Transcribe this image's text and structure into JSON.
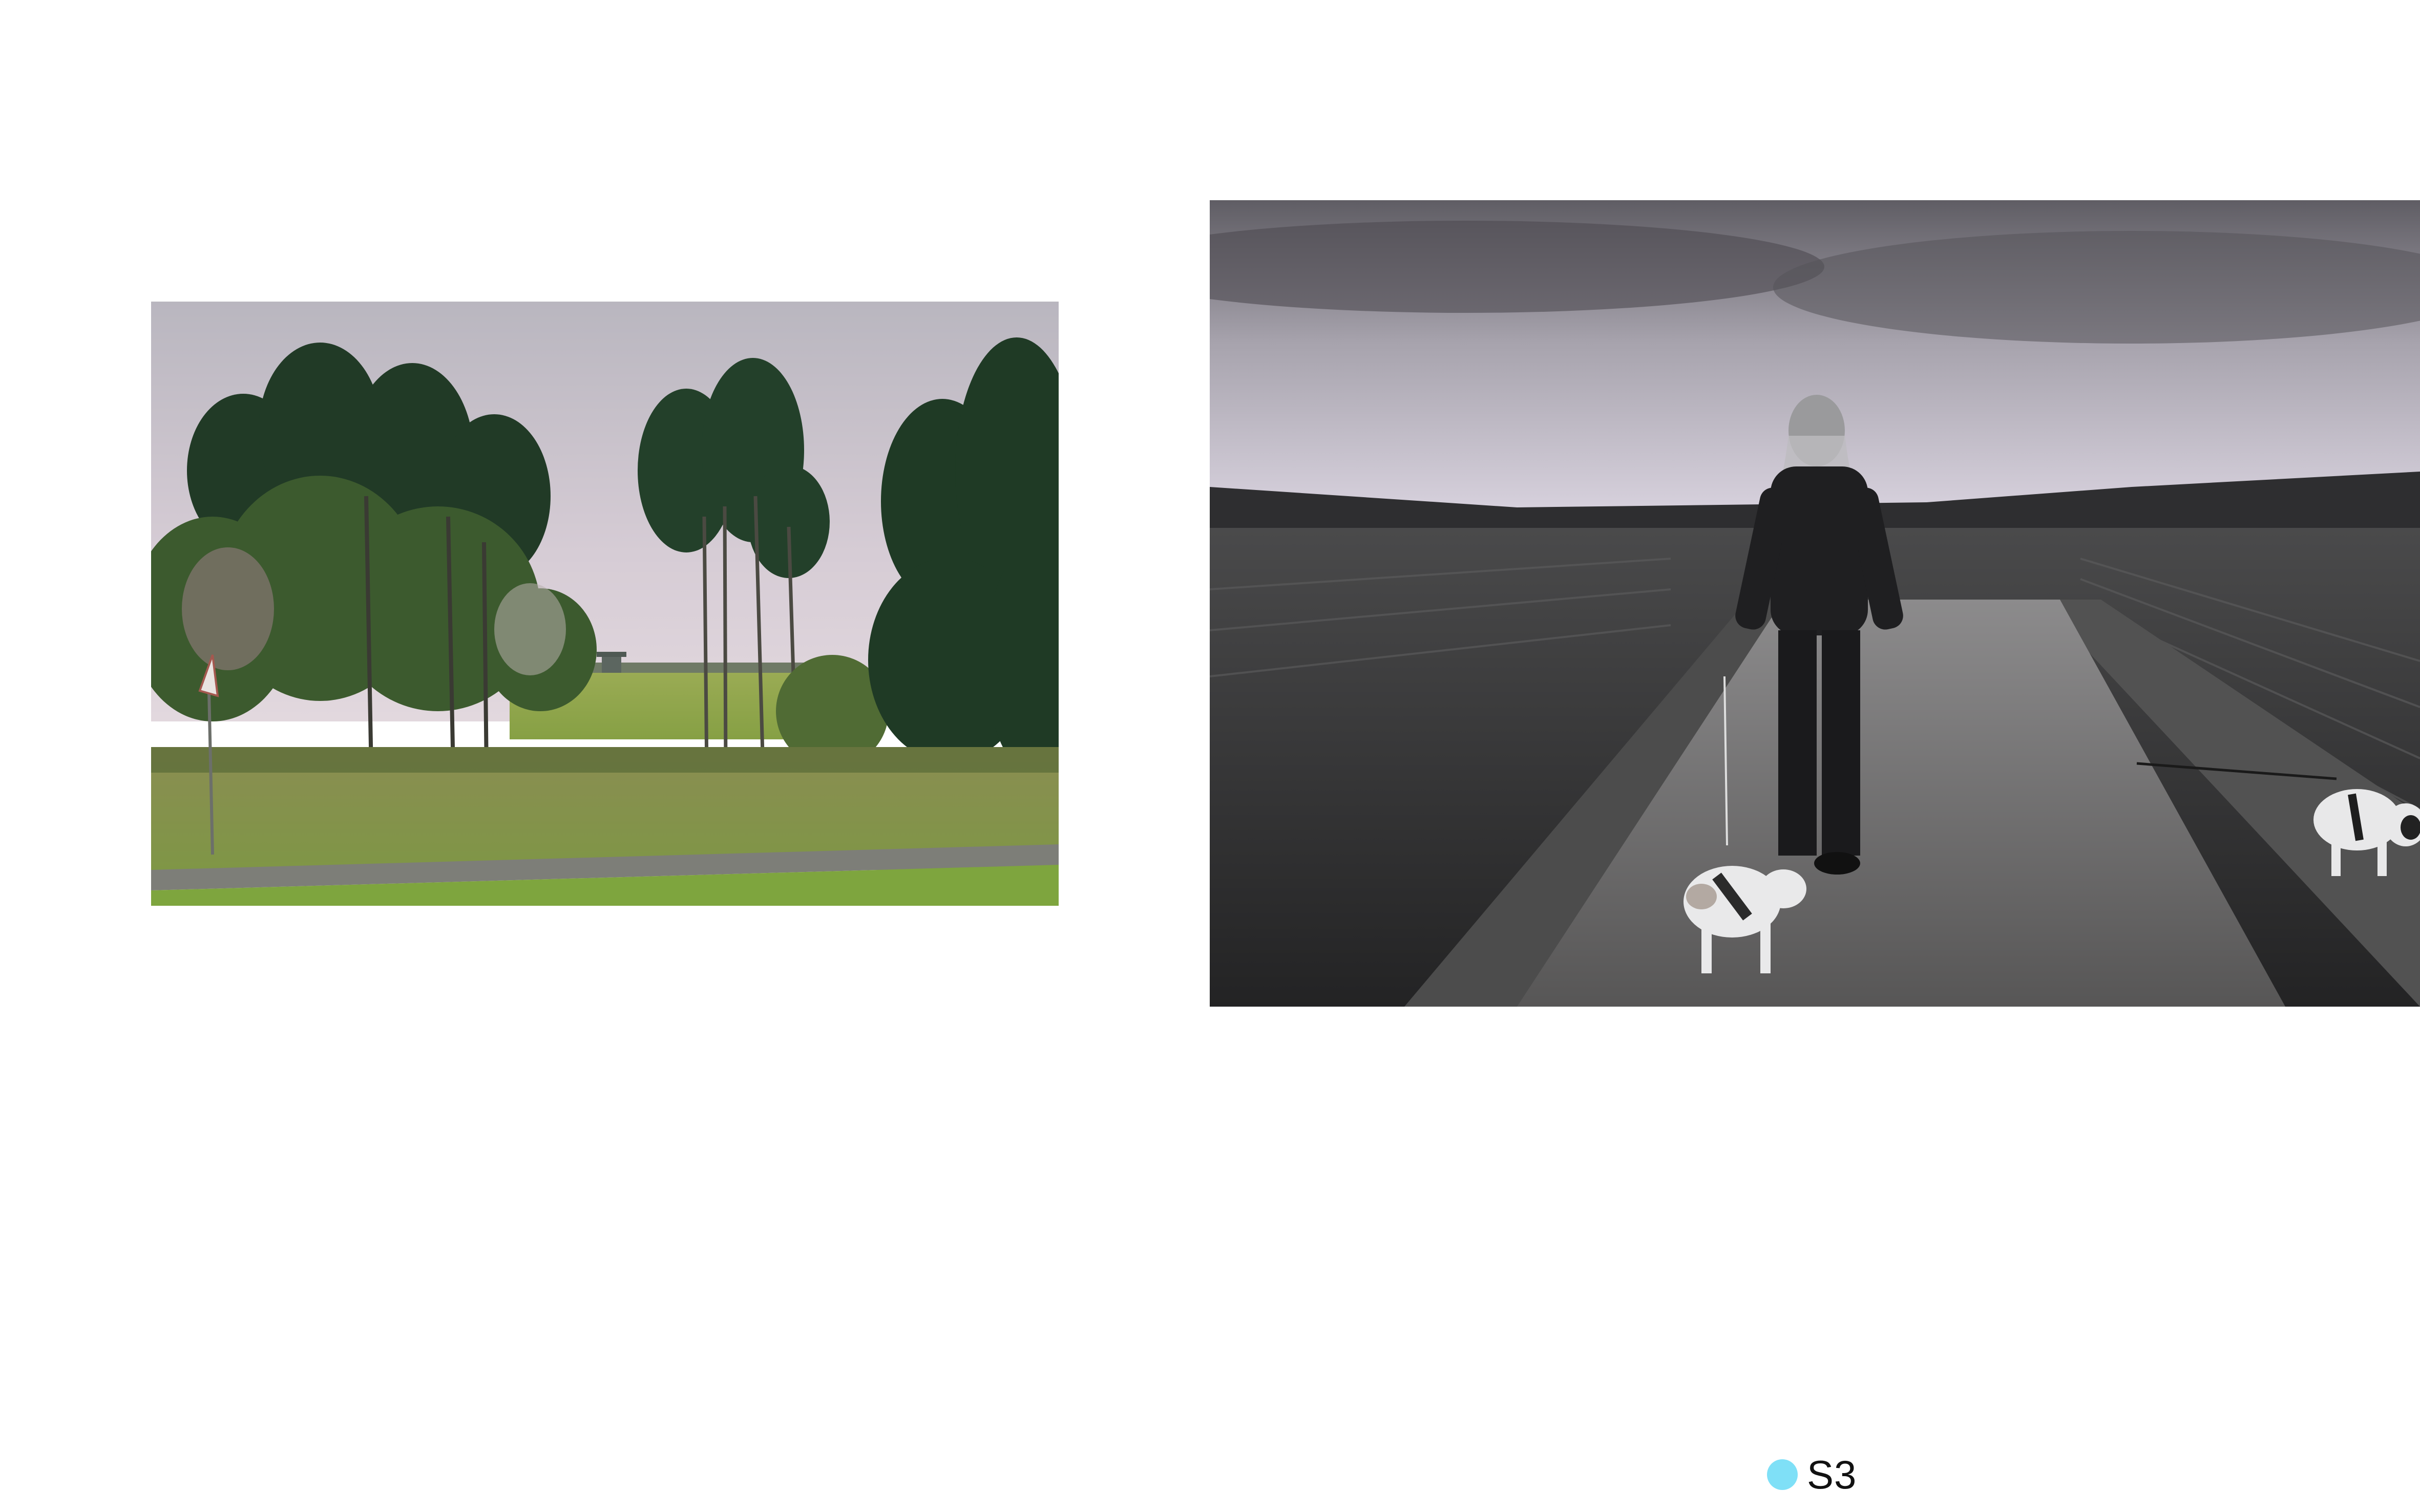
{
  "page": {
    "background": "#ffffff"
  },
  "photos": [
    {
      "id": "landscape-color",
      "subject": "trees-meadow-field",
      "tone": "color"
    },
    {
      "id": "portrait-bw",
      "subject": "woman-walking-two-dogs-on-field-path",
      "tone": "monochrome"
    }
  ],
  "marker": {
    "label": "S3",
    "dot_color": "#7fe0f7"
  }
}
